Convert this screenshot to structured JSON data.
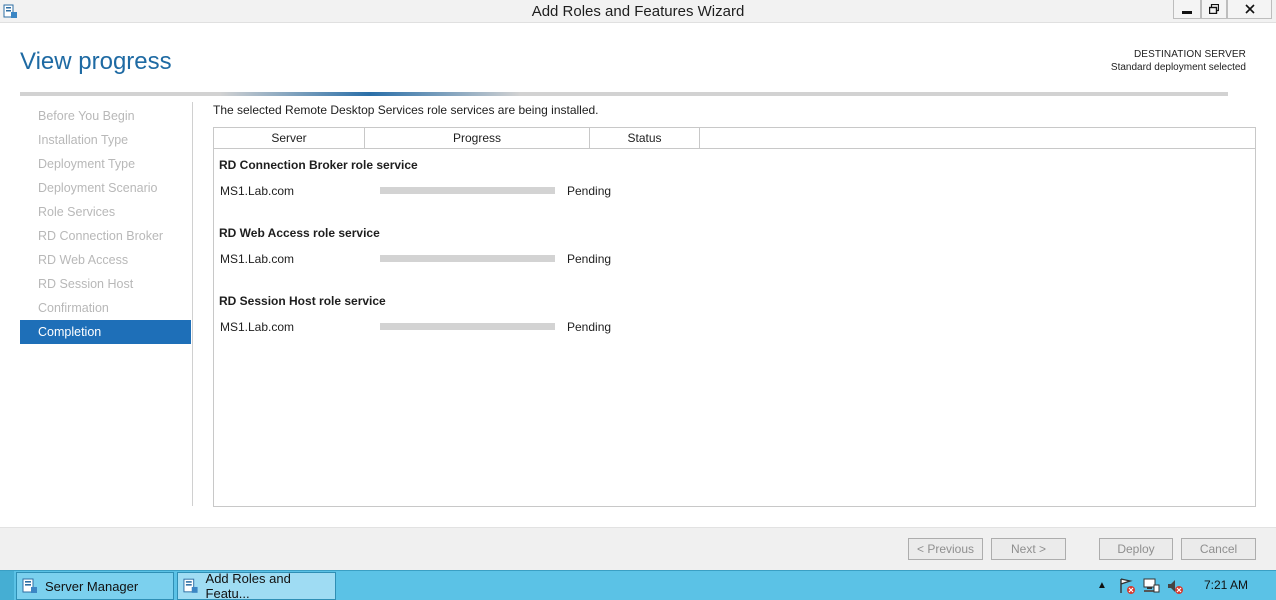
{
  "window": {
    "title": "Add Roles and Features Wizard"
  },
  "header": {
    "title": "View progress",
    "destination_label": "DESTINATION SERVER",
    "destination_value": "Standard deployment selected"
  },
  "nav": {
    "items": [
      {
        "label": "Before You Begin",
        "active": false
      },
      {
        "label": "Installation Type",
        "active": false
      },
      {
        "label": "Deployment Type",
        "active": false
      },
      {
        "label": "Deployment Scenario",
        "active": false
      },
      {
        "label": "Role Services",
        "active": false
      },
      {
        "label": "RD Connection Broker",
        "active": false
      },
      {
        "label": "RD Web Access",
        "active": false
      },
      {
        "label": "RD Session Host",
        "active": false
      },
      {
        "label": "Confirmation",
        "active": false
      },
      {
        "label": "Completion",
        "active": true
      }
    ]
  },
  "main": {
    "intro": "The selected Remote Desktop Services role services are being installed.",
    "columns": [
      "Server",
      "Progress",
      "Status"
    ],
    "groups": [
      {
        "title": "RD Connection Broker role service",
        "server": "MS1.Lab.com",
        "progress": 0,
        "status": "Pending"
      },
      {
        "title": "RD Web Access role service",
        "server": "MS1.Lab.com",
        "progress": 0,
        "status": "Pending"
      },
      {
        "title": "RD Session Host role service",
        "server": "MS1.Lab.com",
        "progress": 0,
        "status": "Pending"
      }
    ]
  },
  "footer": {
    "previous": "< Previous",
    "next": "Next >",
    "deploy": "Deploy",
    "cancel": "Cancel"
  },
  "taskbar": {
    "items": [
      {
        "label": "Server Manager",
        "icon": "server-manager-icon"
      },
      {
        "label": "Add Roles and Featu...",
        "icon": "wizard-icon"
      }
    ],
    "tray_icons": [
      "action-center-icon",
      "network-icon",
      "volume-muted-icon"
    ],
    "clock": "7:21 AM"
  },
  "colors": {
    "accent": "#1e6fb8",
    "title": "#1e6aa3",
    "taskbar": "#5bc2e6"
  }
}
